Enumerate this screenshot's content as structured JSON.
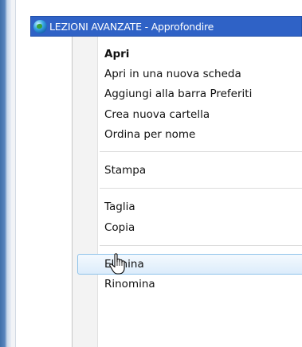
{
  "favorites": {
    "item_title": "LEZIONI AVANZATE - Approfondire",
    "icon": "globe-icon"
  },
  "context_menu": {
    "items": [
      {
        "label": "Apri",
        "bold": true
      },
      {
        "label": "Apri in una nuova scheda"
      },
      {
        "label": "Aggiungi alla barra Preferiti"
      },
      {
        "label": "Crea nuova cartella"
      },
      {
        "label": "Ordina per nome"
      },
      {
        "label": "Stampa"
      },
      {
        "label": "Taglia"
      },
      {
        "label": "Copia"
      },
      {
        "label": "Elimina",
        "hovered": true
      },
      {
        "label": "Rinomina"
      }
    ]
  },
  "cursor": {
    "icon": "hand-pointer-icon"
  },
  "colors": {
    "favorite_bar": "#2f62c6",
    "hover_border": "#8fc3ea"
  }
}
